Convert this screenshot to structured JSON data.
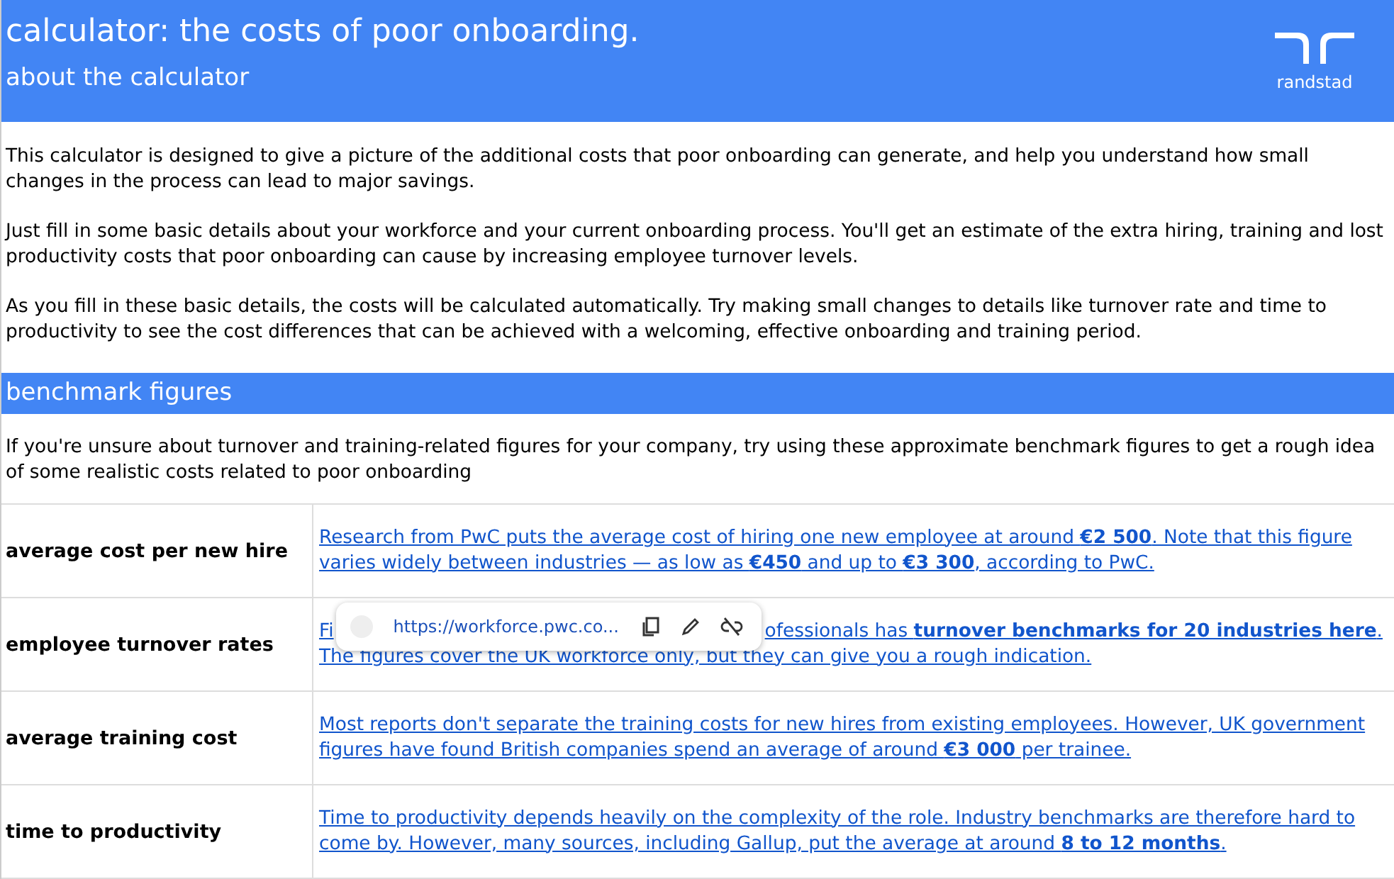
{
  "header": {
    "title": "calculator: the costs of poor onboarding.",
    "subtitle": "about the calculator",
    "logo_text": "randstad"
  },
  "intro": [
    "This calculator is designed to give a picture of the additional costs that poor onboarding can generate, and help you understand how small changes in the process can lead to major savings.",
    "Just fill in some basic details about your workforce and your current onboarding process. You'll get an estimate of the extra hiring, training and lost productivity costs that poor onboarding can cause by increasing employee turnover levels.",
    "As you fill in these basic details, the costs will be calculated automatically. Try making small changes to details like turnover rate and time to productivity to see the cost differences that can be achieved with a welcoming, effective onboarding and training period."
  ],
  "benchmark": {
    "heading": "benchmark figures",
    "description": "If you're unsure about turnover and training-related figures for your company, try using these approximate benchmark figures to get a rough idea of some realistic costs related to poor onboarding",
    "rows": [
      {
        "label": "average cost per new hire",
        "lines": [
          "Research from PwC puts the average cost of hiring one new employee at around **€2 500**. Note that this figure varies widely between industries — as low as **€450** and up to **€3 300**, according to PwC."
        ]
      },
      {
        "label": "employee turnover rates",
        "covered": true,
        "lines": [
          "Fi",
          "ofessionals has **turnover benchmarks for 20 industries here**.",
          "The figures cover the UK workforce only, but they can give you a rough indication."
        ]
      },
      {
        "label": "average training cost",
        "lines": [
          "Most reports don't separate the training costs for new hires from existing employees. However, UK government figures have found British companies spend an average of around **€3 000** per trainee."
        ]
      },
      {
        "label": "time to productivity",
        "lines": [
          "Time to productivity depends heavily on the complexity of the role. Industry benchmarks are therefore hard to come by. However, many sources, including Gallup, put the average at around **8 to 12 months**."
        ]
      }
    ]
  },
  "link_popup": {
    "url": "https://workforce.pwc.co..."
  }
}
